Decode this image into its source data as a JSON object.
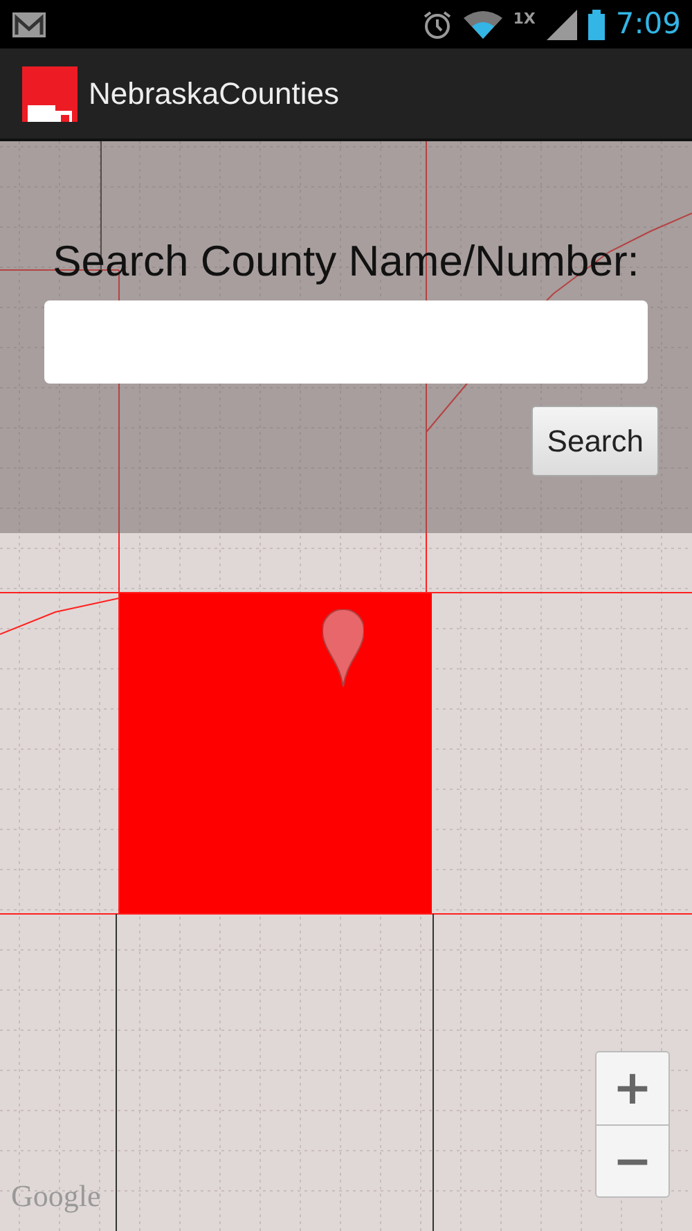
{
  "status_bar": {
    "network": "1X",
    "time": "7:09"
  },
  "app_bar": {
    "title": "NebraskaCounties"
  },
  "search": {
    "label": "Search County Name/Number:",
    "button": "Search"
  },
  "map": {
    "zoom_in": "+",
    "zoom_out": "−",
    "attribution": "Google"
  }
}
